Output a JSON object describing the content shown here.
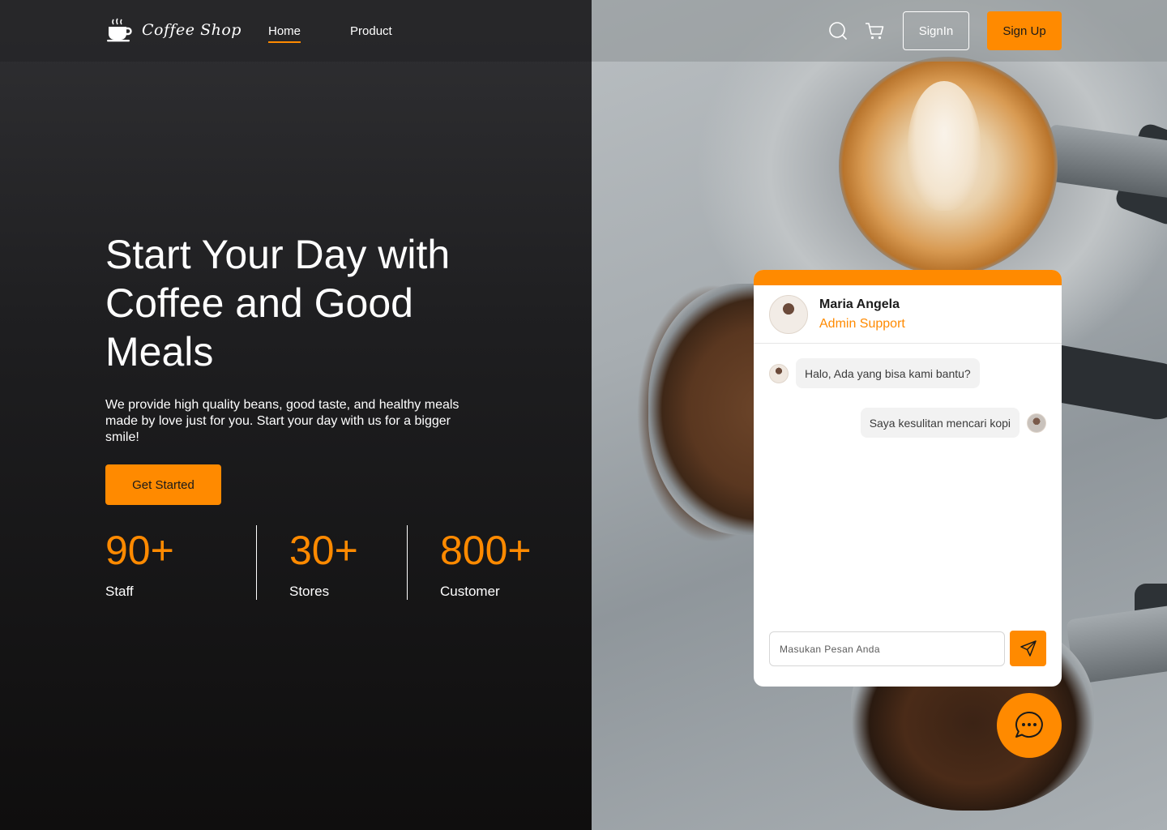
{
  "brand": {
    "name": "Coffee Shop",
    "logo_icon": "coffee-cup-icon",
    "accent": "#ff8a00"
  },
  "nav": {
    "items": [
      {
        "label": "Home",
        "active": true
      },
      {
        "label": "Product",
        "active": false
      }
    ],
    "search_icon": "search-icon",
    "cart_icon": "cart-icon",
    "signin_label": "SignIn",
    "signup_label": "Sign Up"
  },
  "hero": {
    "title": "Start Your Day with Coffee and Good Meals",
    "description": "We provide high quality beans, good taste, and healthy meals made by love just for you. Start your day with us for a bigger smile!",
    "cta_label": "Get Started"
  },
  "stats": [
    {
      "value": "90+",
      "label": "Staff"
    },
    {
      "value": "30+",
      "label": "Stores"
    },
    {
      "value": "800+",
      "label": "Customer"
    }
  ],
  "chat": {
    "agent_name": "Maria Angela",
    "agent_role": "Admin Support",
    "messages": [
      {
        "from": "agent",
        "text": "Halo, Ada yang bisa kami bantu?"
      },
      {
        "from": "user",
        "text": "Saya kesulitan mencari kopi"
      }
    ],
    "input_placeholder": "Masukan Pesan Anda",
    "send_icon": "send-icon",
    "fab_icon": "chat-bubble-icon"
  }
}
